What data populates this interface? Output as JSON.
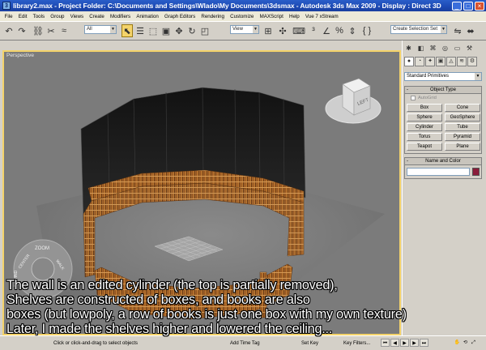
{
  "window": {
    "title": "library2.max - Project Folder: C:\\Documents and Settings\\Wlado\\My Documents\\3dsmax - Autodesk 3ds Max 2009 - Display : Direct 3D",
    "app_icon_letter": "3"
  },
  "menu": [
    "File",
    "Edit",
    "Tools",
    "Group",
    "Views",
    "Create",
    "Modifiers",
    "Animation",
    "Graph Editors",
    "Rendering",
    "Customize",
    "MAXScript",
    "Help",
    "Vue 7 xStream"
  ],
  "toolbar": {
    "selection_filter": "All",
    "coord_system": "View",
    "named_selection_placeholder": "Create Selection Set"
  },
  "viewport": {
    "label": "Perspective",
    "viewcube_label": "LEFT",
    "steering_wheel": {
      "zoom": "ZOOM",
      "center": "CENTER",
      "walk": "WALK",
      "rewind": "REWIND"
    }
  },
  "command_panel": {
    "category": "Standard Primitives",
    "object_type_title": "Object Type",
    "autogrid_label": "AutoGrid",
    "object_buttons": [
      "Box",
      "Cone",
      "Sphere",
      "GeoSphere",
      "Cylinder",
      "Tube",
      "Torus",
      "Pyramid",
      "Teapot",
      "Plane"
    ],
    "name_color_title": "Name and Color",
    "object_color": "#8b1c3a"
  },
  "status_bar": {
    "prompt": "Click or click-and-drag to select objects",
    "add_time_tag": "Add Time Tag",
    "set_key": "Set Key",
    "key_filters": "Key Filters..."
  },
  "subtitle": [
    "The wall is an edited cylinder (the top is partially removed),",
    "Shelves are constructed of boxes, and books are also",
    "boxes (but lowpoly, a row of books is just one box with my own texture)",
    "Later, I made the shelves higher and lowered the ceiling..."
  ],
  "colors": {
    "titlebar": "#1c49b3",
    "viewport_bg": "#7b7b7b",
    "active_border": "#f4d36a",
    "wall": "#1f1f1f",
    "shelf": "#b5712e"
  }
}
